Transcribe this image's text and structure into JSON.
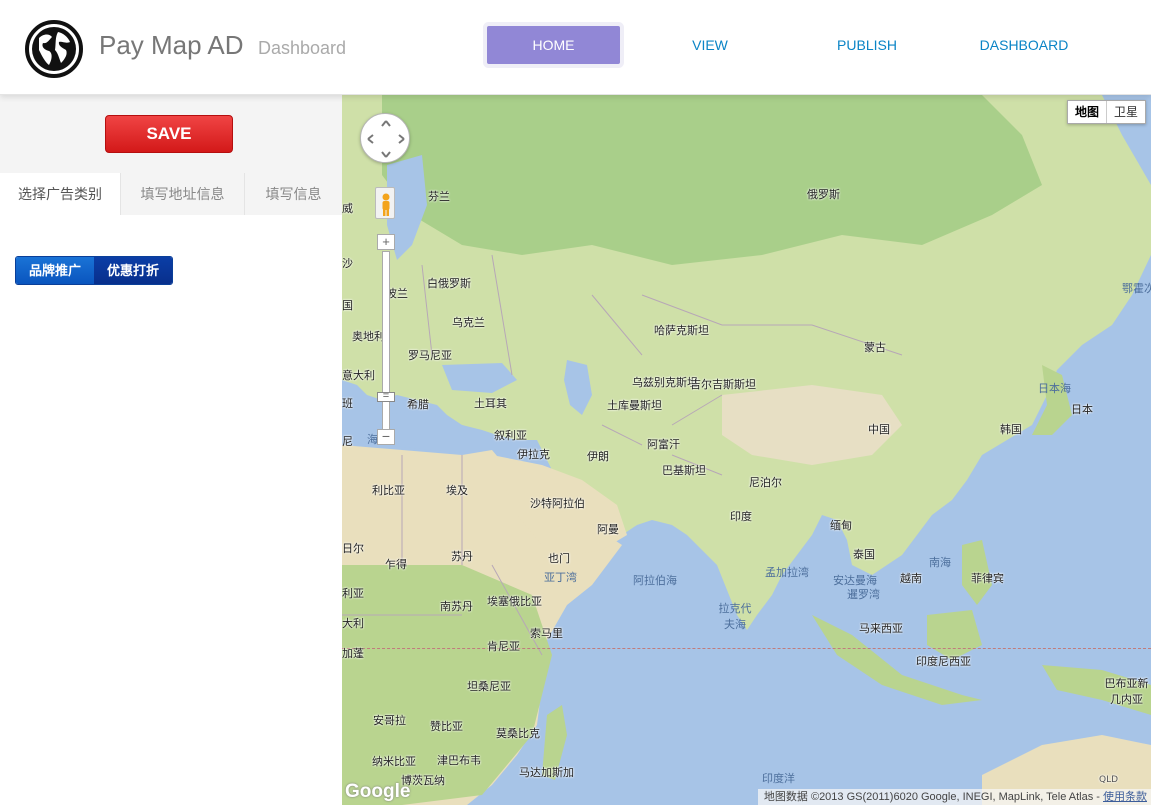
{
  "header": {
    "brand": "Pay Map AD",
    "subtitle": "Dashboard",
    "nav": [
      {
        "label": "HOME",
        "active": true
      },
      {
        "label": "VIEW",
        "active": false
      },
      {
        "label": "PUBLISH",
        "active": false
      },
      {
        "label": "DASHBOARD",
        "active": false
      }
    ]
  },
  "sidebar": {
    "save_label": "SAVE",
    "tabs": [
      {
        "label": "选择广告类别",
        "active": true
      },
      {
        "label": "填写地址信息",
        "active": false
      },
      {
        "label": "填写信息",
        "active": false
      }
    ],
    "categories": [
      {
        "label": "品牌推广",
        "active": false
      },
      {
        "label": "优惠打折",
        "active": true
      }
    ]
  },
  "map": {
    "type_toggle": {
      "map": "地图",
      "satellite": "卫星"
    },
    "logo": "Google",
    "attribution": "地图数据 ©2013 GS(2011)6020 Google, INEGI, MapLink, Tele Atlas - ",
    "terms_link": "使用条款",
    "labels": {
      "finland": "芬兰",
      "russia": "俄罗斯",
      "norway_partial": "威",
      "poland": "波兰",
      "belarus": "白俄罗斯",
      "ukraine": "乌克兰",
      "austria": "奥地利",
      "romania": "罗马尼亚",
      "italy_partial": "意大利",
      "greece": "希腊",
      "turkey": "土耳其",
      "kazakhstan": "哈萨克斯坦",
      "mongolia": "蒙古",
      "uzbekistan": "乌兹别克斯坦",
      "kyrgyzstan": "吉尔吉斯斯坦",
      "turkmenistan": "土库曼斯坦",
      "syria": "叙利亚",
      "iraq": "伊拉克",
      "iran": "伊朗",
      "afghanistan": "阿富汗",
      "pakistan": "巴基斯坦",
      "china": "中国",
      "japan_sea": "日本海",
      "japan": "日本",
      "korea": "韩国",
      "okhotsk_partial": "鄂霍次克海",
      "libya": "利比亚",
      "egypt": "埃及",
      "saudi": "沙特阿拉伯",
      "oman": "阿曼",
      "nepal": "尼泊尔",
      "india": "印度",
      "myanmar": "缅甸",
      "thailand": "泰国",
      "vietnam": "越南",
      "philippines": "菲律宾",
      "south_china_sea": "南海",
      "bay_of_bengal": "孟加拉湾",
      "andaman": "安达曼海",
      "gulf_of_thailand": "暹罗湾",
      "arabian_sea": "阿拉伯海",
      "gulf_of_aden": "亚丁湾",
      "laccadive": "拉克代夫海",
      "malaysia": "马来西亚",
      "indonesia": "印度尼西亚",
      "sudan": "苏丹",
      "chad": "乍得",
      "yemen": "也门",
      "ethiopia": "埃塞俄比亚",
      "south_sudan": "南苏丹",
      "kenya": "肯尼亚",
      "somalia": "索马里",
      "tanzania": "坦桑尼亚",
      "angola": "安哥拉",
      "zambia": "赞比亚",
      "mozambique": "莫桑比克",
      "namibia": "纳米比亚",
      "zimbabwe": "津巴布韦",
      "botswana": "博茨瓦纳",
      "madagascar": "马达加斯加",
      "indian_ocean": "印度洋",
      "png": "巴布亚新几内亚",
      "qld": "QLD",
      "nigeria_partial": "日尔",
      "algeria_partial": "利亚",
      "gabon_partial": "加蓬",
      "benin_partial": "尼",
      "spain_partial": "班",
      "med_partial": "海",
      "italy_partial2": "大利",
      "germany_partial": "国",
      "estonia_partial": "沙"
    }
  }
}
